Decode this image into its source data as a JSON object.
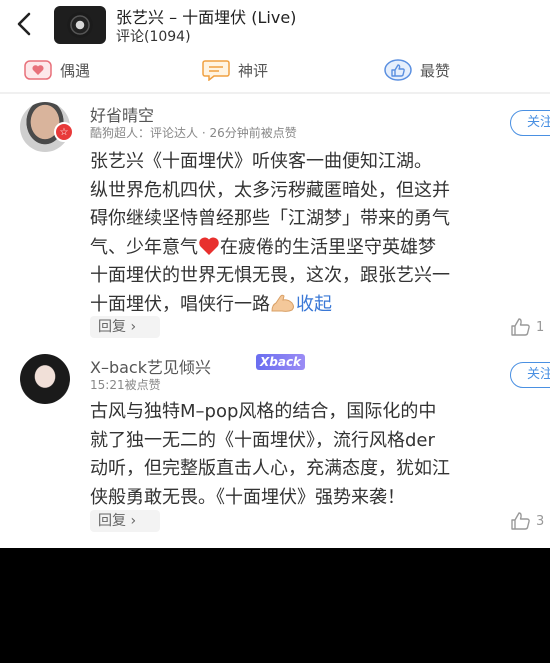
{
  "header": {
    "song_title": "张艺兴 – 十面埋伏 (Live)",
    "comment_count": "评论(1094)"
  },
  "tabs": [
    {
      "label": "偶遇",
      "icon": "heart-card-icon"
    },
    {
      "label": "神评",
      "icon": "chat-bubble-icon"
    },
    {
      "label": "最赞",
      "icon": "thumbs-up-icon"
    }
  ],
  "comments": [
    {
      "username": "好省晴空",
      "meta": "酷狗超人：评论达人 · 26分钟前被点赞",
      "badge": "☆",
      "follow_label": "关注",
      "lines": [
        "张艺兴《十面埋伏》听侠客一曲便知江湖。",
        "纵世界危机四伏，太多污秽藏匿暗处，但这并",
        "碍你继续坚恃曾经那些「江湖梦」带来的勇气",
        "气、少年意气",
        "在疲倦的生活里坚守英雄梦",
        "十面埋伏的世界无惧无畏，这次，跟张艺兴一",
        "十面埋伏，唱侠行一路",
        "收起"
      ],
      "reply_label": "回复 ›",
      "likes": "1"
    },
    {
      "username": "X–back艺见倾兴",
      "tag": "Xback",
      "meta": "15:21被点赞",
      "follow_label": "关注",
      "lines": [
        "古风与独特M–pop风格的结合，国际化的中",
        "就了独一无二的《十面埋伏》，流行风格der",
        "动听，但完整版直击人心，充满态度，犹如江",
        "侠般勇敢无畏。《十面埋伏》强势来袭！"
      ],
      "reply_label": "回复 ›",
      "likes": "3"
    }
  ],
  "colors": {
    "accent_blue": "#4a90e2",
    "tab_red": "#e8707a",
    "tab_orange": "#f0a040",
    "tab_blue": "#5a8fe0",
    "badge_red": "#e83a3a"
  }
}
